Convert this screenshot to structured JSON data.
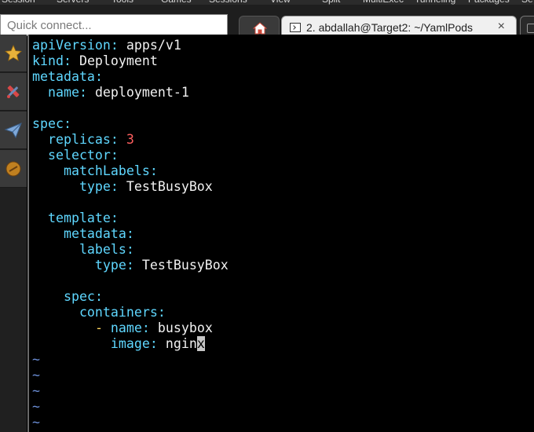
{
  "menu": {
    "items": [
      "Session",
      "Servers",
      "Tools",
      "Games",
      "Sessions",
      "View",
      "Split",
      "MultiExec",
      "Tunneling",
      "Packages",
      "Se"
    ]
  },
  "quick_connect": {
    "placeholder": "Quick connect..."
  },
  "tabs": {
    "home_icon": "home-icon",
    "active": {
      "label": "2. abdallah@Target2: ~/YamlPods",
      "close": "×",
      "icon": "terminal-icon"
    }
  },
  "sidebar": {
    "icons": [
      "star-icon",
      "tools-icon",
      "send-icon",
      "macro-icon"
    ]
  },
  "editor": {
    "lines": [
      [
        {
          "t": "apiVersion",
          "c": "k"
        },
        {
          "t": ": ",
          "c": "k"
        },
        {
          "t": "apps/v1",
          "c": "v"
        }
      ],
      [
        {
          "t": "kind",
          "c": "k"
        },
        {
          "t": ": ",
          "c": "k"
        },
        {
          "t": "Deployment",
          "c": "v"
        }
      ],
      [
        {
          "t": "metadata",
          "c": "k"
        },
        {
          "t": ":",
          "c": "k"
        }
      ],
      [
        {
          "t": "  name",
          "c": "k"
        },
        {
          "t": ": ",
          "c": "k"
        },
        {
          "t": "deployment-1",
          "c": "v"
        }
      ],
      [],
      [
        {
          "t": "spec",
          "c": "k"
        },
        {
          "t": ":",
          "c": "k"
        }
      ],
      [
        {
          "t": "  replicas",
          "c": "k"
        },
        {
          "t": ": ",
          "c": "k"
        },
        {
          "t": "3",
          "c": "n"
        }
      ],
      [
        {
          "t": "  selector",
          "c": "k"
        },
        {
          "t": ":",
          "c": "k"
        }
      ],
      [
        {
          "t": "    matchLabels",
          "c": "k"
        },
        {
          "t": ":",
          "c": "k"
        }
      ],
      [
        {
          "t": "      type",
          "c": "k"
        },
        {
          "t": ": ",
          "c": "k"
        },
        {
          "t": "TestBusyBox",
          "c": "v"
        }
      ],
      [],
      [
        {
          "t": "  template",
          "c": "k"
        },
        {
          "t": ":",
          "c": "k"
        }
      ],
      [
        {
          "t": "    metadata",
          "c": "k"
        },
        {
          "t": ":",
          "c": "k"
        }
      ],
      [
        {
          "t": "      labels",
          "c": "k"
        },
        {
          "t": ":",
          "c": "k"
        }
      ],
      [
        {
          "t": "        type",
          "c": "k"
        },
        {
          "t": ": ",
          "c": "k"
        },
        {
          "t": "TestBusyBox",
          "c": "v"
        }
      ],
      [],
      [
        {
          "t": "    spec",
          "c": "k"
        },
        {
          "t": ":",
          "c": "k"
        }
      ],
      [
        {
          "t": "      containers",
          "c": "k"
        },
        {
          "t": ":",
          "c": "k"
        }
      ],
      [
        {
          "t": "        ",
          "c": "v"
        },
        {
          "t": "- ",
          "c": "d"
        },
        {
          "t": "name",
          "c": "k"
        },
        {
          "t": ": ",
          "c": "k"
        },
        {
          "t": "busybox",
          "c": "v"
        }
      ],
      [
        {
          "t": "          image",
          "c": "k"
        },
        {
          "t": ": ",
          "c": "k"
        },
        {
          "t": "ngin",
          "c": "v"
        },
        {
          "t": "x",
          "c": "cur"
        }
      ],
      [
        {
          "t": "~",
          "c": "t"
        }
      ],
      [
        {
          "t": "~",
          "c": "t"
        }
      ],
      [
        {
          "t": "~",
          "c": "t"
        }
      ],
      [
        {
          "t": "~",
          "c": "t"
        }
      ],
      [
        {
          "t": "~",
          "c": "t"
        }
      ]
    ]
  }
}
